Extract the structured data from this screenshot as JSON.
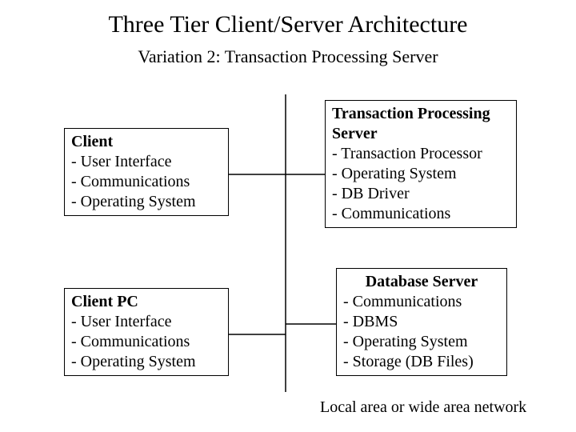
{
  "title": "Three Tier Client/Server Architecture",
  "subtitle": "Variation 2: Transaction Processing Server",
  "boxes": {
    "client": {
      "header": "Client",
      "items": [
        "- User Interface",
        "- Communications",
        "- Operating System"
      ]
    },
    "tp_server": {
      "header": "Transaction Processing Server",
      "items": [
        "- Transaction Processor",
        "- Operating System",
        "- DB Driver",
        "- Communications"
      ]
    },
    "client_pc": {
      "header": "Client PC",
      "items": [
        "- User Interface",
        "- Communications",
        "- Operating System"
      ]
    },
    "db_server": {
      "header": "Database Server",
      "items": [
        "- Communications",
        "- DBMS",
        "- Operating System",
        "- Storage (DB Files)"
      ]
    }
  },
  "caption": "Local area or wide area network"
}
